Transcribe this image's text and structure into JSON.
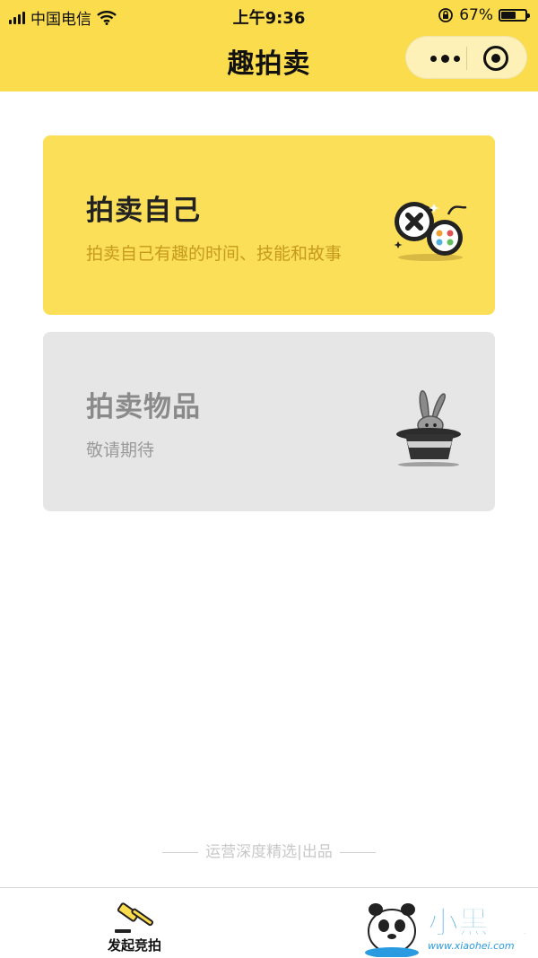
{
  "status_bar": {
    "carrier": "中国电信",
    "time": "上午9:36",
    "battery_percent": "67%",
    "battery_level": 0.67
  },
  "nav": {
    "title": "趣拍卖",
    "more_icon": "more-dots-icon",
    "close_icon": "target-circle-icon"
  },
  "cards": [
    {
      "title": "拍卖自己",
      "subtitle": "拍卖自己有趣的时间、技能和故事",
      "icon": "gamepad-icon"
    },
    {
      "title": "拍卖物品",
      "subtitle": "敬请期待",
      "icon": "magic-hat-rabbit-icon"
    }
  ],
  "footer": {
    "credit": "运营深度精选|出品"
  },
  "tabbar": {
    "items": [
      {
        "label": "发起竞拍",
        "icon": "gavel-icon"
      }
    ]
  },
  "watermark": {
    "text": "小黑游戏",
    "url_text": "www.xiaohei.com"
  },
  "colors": {
    "accent": "#fbdc4c",
    "card_self": "#fbdf58",
    "card_goods": "#e6e6e6",
    "subtitle_gold": "#c79a1e"
  }
}
